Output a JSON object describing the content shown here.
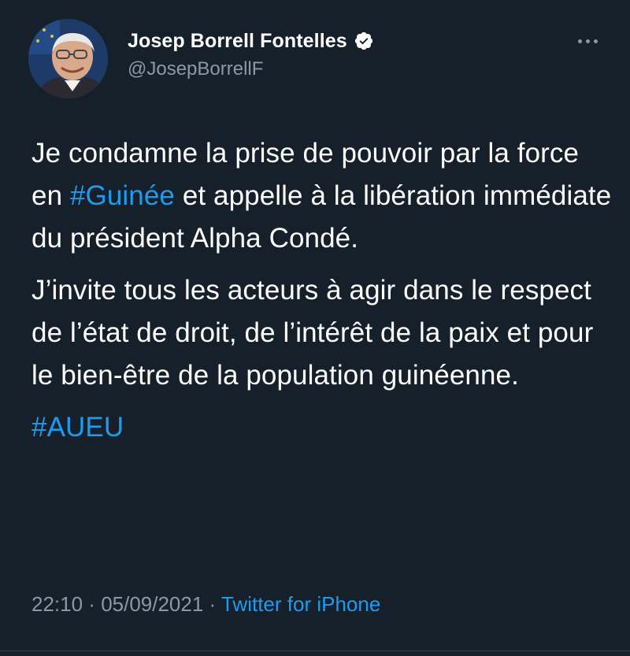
{
  "author": {
    "display_name": "Josep Borrell Fontelles",
    "handle": "@JosepBorrellF",
    "avatar_icon": "profile-photo",
    "verified_icon": "verified-badge-icon",
    "more_icon": "more-horizontal-icon"
  },
  "tweet": {
    "paragraph1": {
      "part1": "Je condamne la prise de pouvoir par la force en ",
      "hashtag": "#Guinée",
      "part2": " et appelle à la libération immédiate du président Alpha Condé."
    },
    "paragraph2": "J’invite tous les acteurs à agir dans le respect de l’état de droit, de l’intérêt de la paix et pour le bien-être de la population guinéenne.",
    "hashtag_line": "#AUEU"
  },
  "footer": {
    "time": "22:10",
    "separator1": " · ",
    "date": "05/09/2021",
    "separator2": " · ",
    "source": "Twitter for iPhone"
  },
  "colors": {
    "background": "#15202b",
    "link": "#1d9bf0",
    "muted": "#8b98a5",
    "text": "#ffffff"
  }
}
